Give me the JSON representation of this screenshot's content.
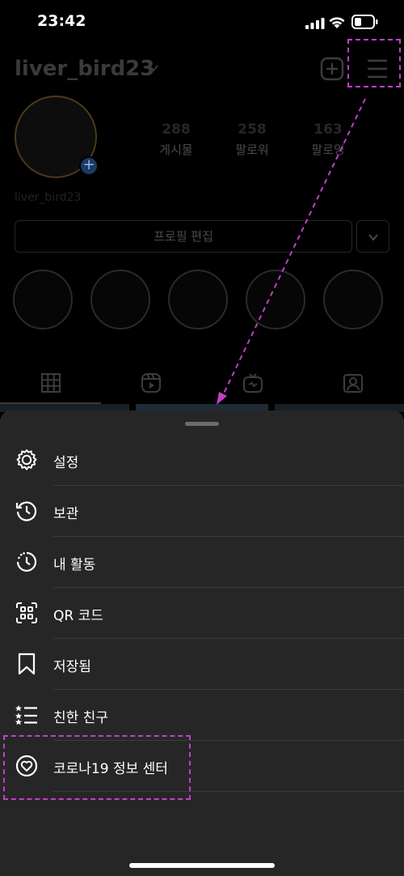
{
  "status_bar": {
    "time": "23:42"
  },
  "profile": {
    "username": "liver_bird23",
    "display_name": "liver_bird23",
    "stats": [
      {
        "value": "288",
        "label": "게시물"
      },
      {
        "value": "258",
        "label": "팔로워"
      },
      {
        "value": "163",
        "label": "팔로잉"
      }
    ],
    "edit_profile_label": "프로필 편집"
  },
  "sheet": {
    "items": [
      {
        "label": "설정",
        "icon": "settings-gear-icon"
      },
      {
        "label": "보관",
        "icon": "archive-history-icon"
      },
      {
        "label": "내 활동",
        "icon": "activity-clock-icon"
      },
      {
        "label": "QR 코드",
        "icon": "qr-code-icon"
      },
      {
        "label": "저장됨",
        "icon": "bookmark-icon"
      },
      {
        "label": "친한 친구",
        "icon": "close-friends-list-icon"
      },
      {
        "label": "코로나19 정보 센터",
        "icon": "covid-info-heart-icon"
      }
    ]
  },
  "colors": {
    "sheet_bg": "#262626",
    "annotation": "#c23fc8"
  }
}
